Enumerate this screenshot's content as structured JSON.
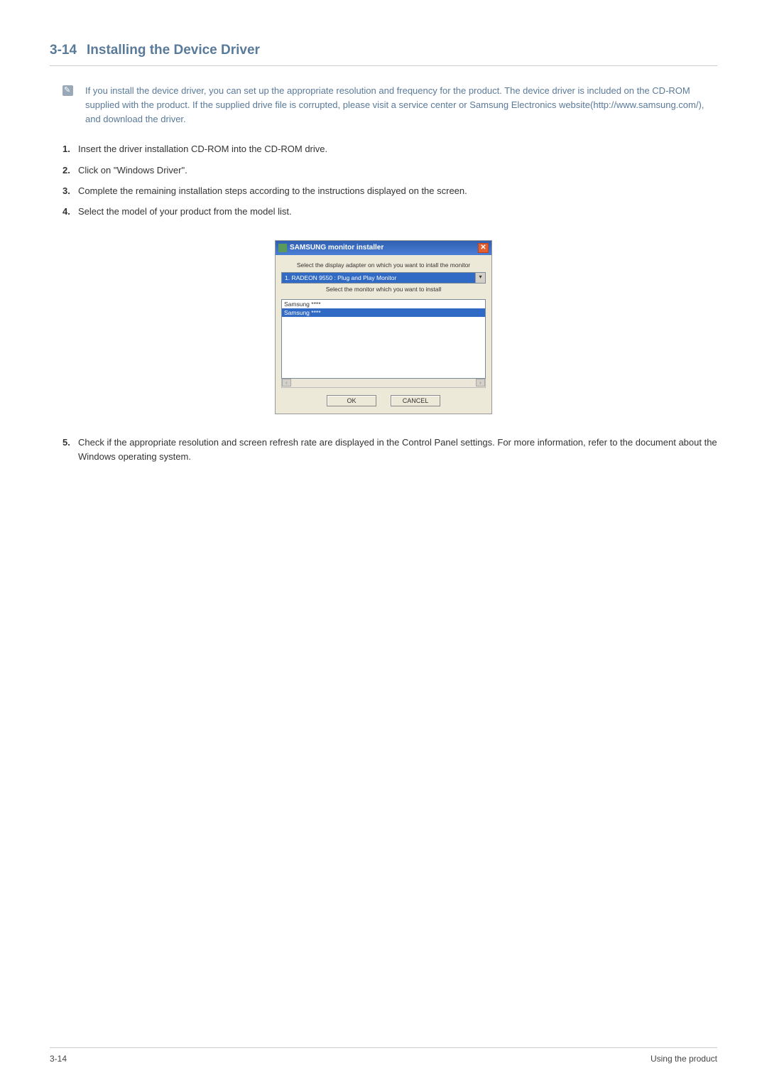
{
  "header": {
    "number": "3-14",
    "title": "Installing the Device Driver"
  },
  "info_note": "If you install the device driver, you can set up the appropriate resolution and frequency for the product. The device driver is included on the CD-ROM supplied with the product. If the supplied drive file is corrupted, please visit a service center or Samsung Electronics website(http://www.samsung.com/), and download the driver.",
  "steps": [
    "Insert the driver installation CD-ROM into the CD-ROM drive.",
    "Click on \"Windows Driver\".",
    "Complete the remaining installation steps according to the instructions displayed on the screen.",
    "Select the model of your product from the model list."
  ],
  "installer": {
    "title": "SAMSUNG monitor installer",
    "close": "✕",
    "label_adapter": "Select the display adapter on which you want to intall the monitor",
    "dropdown_value": "1. RADEON 9550 : Plug and Play Monitor",
    "dropdown_arrow": "▾",
    "label_monitor": "Select the monitor which you want to install",
    "list_item1": "Samsung ****",
    "list_item2": "Samsung ****",
    "scroll_left": "‹",
    "scroll_right": "›",
    "btn_ok": "OK",
    "btn_cancel": "CANCEL"
  },
  "step5": "Check if the appropriate resolution and screen refresh rate are displayed in the Control Panel settings. For more information, refer to the document about the Windows operating system.",
  "footer": {
    "left": "3-14",
    "right": "Using the product"
  }
}
